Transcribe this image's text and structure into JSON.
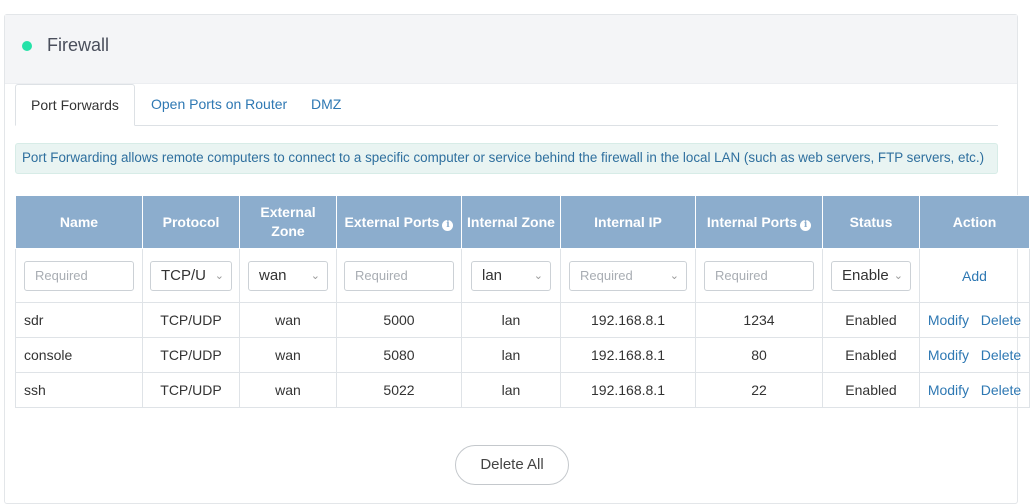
{
  "header": {
    "title": "Firewall",
    "status_color": "#25e2a8"
  },
  "tabs": [
    {
      "label": "Port Forwards",
      "active": true
    },
    {
      "label": "Open Ports on Router",
      "active": false
    },
    {
      "label": "DMZ",
      "active": false
    }
  ],
  "info": "Port Forwarding allows remote computers to connect to a specific computer or service behind the firewall in the local LAN (such as web servers, FTP servers, etc.)",
  "table": {
    "headers": {
      "name": "Name",
      "protocol": "Protocol",
      "external_zone": "External Zone",
      "external_ports": "External Ports",
      "internal_zone": "Internal Zone",
      "internal_ip": "Internal IP",
      "internal_ports": "Internal Ports",
      "status": "Status",
      "action": "Action"
    },
    "new_row": {
      "name_placeholder": "Required",
      "protocol": "TCP/U",
      "external_zone": "wan",
      "external_ports_placeholder": "Required",
      "internal_zone": "lan",
      "internal_ip_placeholder": "Required",
      "internal_ports_placeholder": "Required",
      "status": "Enable",
      "add_label": "Add"
    },
    "rows": [
      {
        "name": "sdr",
        "protocol": "TCP/UDP",
        "external_zone": "wan",
        "external_ports": "5000",
        "internal_zone": "lan",
        "internal_ip": "192.168.8.1",
        "internal_ports": "1234",
        "status": "Enabled",
        "modify": "Modify",
        "delete": "Delete"
      },
      {
        "name": "console",
        "protocol": "TCP/UDP",
        "external_zone": "wan",
        "external_ports": "5080",
        "internal_zone": "lan",
        "internal_ip": "192.168.8.1",
        "internal_ports": "80",
        "status": "Enabled",
        "modify": "Modify",
        "delete": "Delete"
      },
      {
        "name": "ssh",
        "protocol": "TCP/UDP",
        "external_zone": "wan",
        "external_ports": "5022",
        "internal_zone": "lan",
        "internal_ip": "192.168.8.1",
        "internal_ports": "22",
        "status": "Enabled",
        "modify": "Modify",
        "delete": "Delete"
      }
    ]
  },
  "delete_all_label": "Delete All",
  "colors": {
    "header_bg": "#8cadcd",
    "link": "#2e78b3",
    "info_bg": "#e9f4f2"
  }
}
